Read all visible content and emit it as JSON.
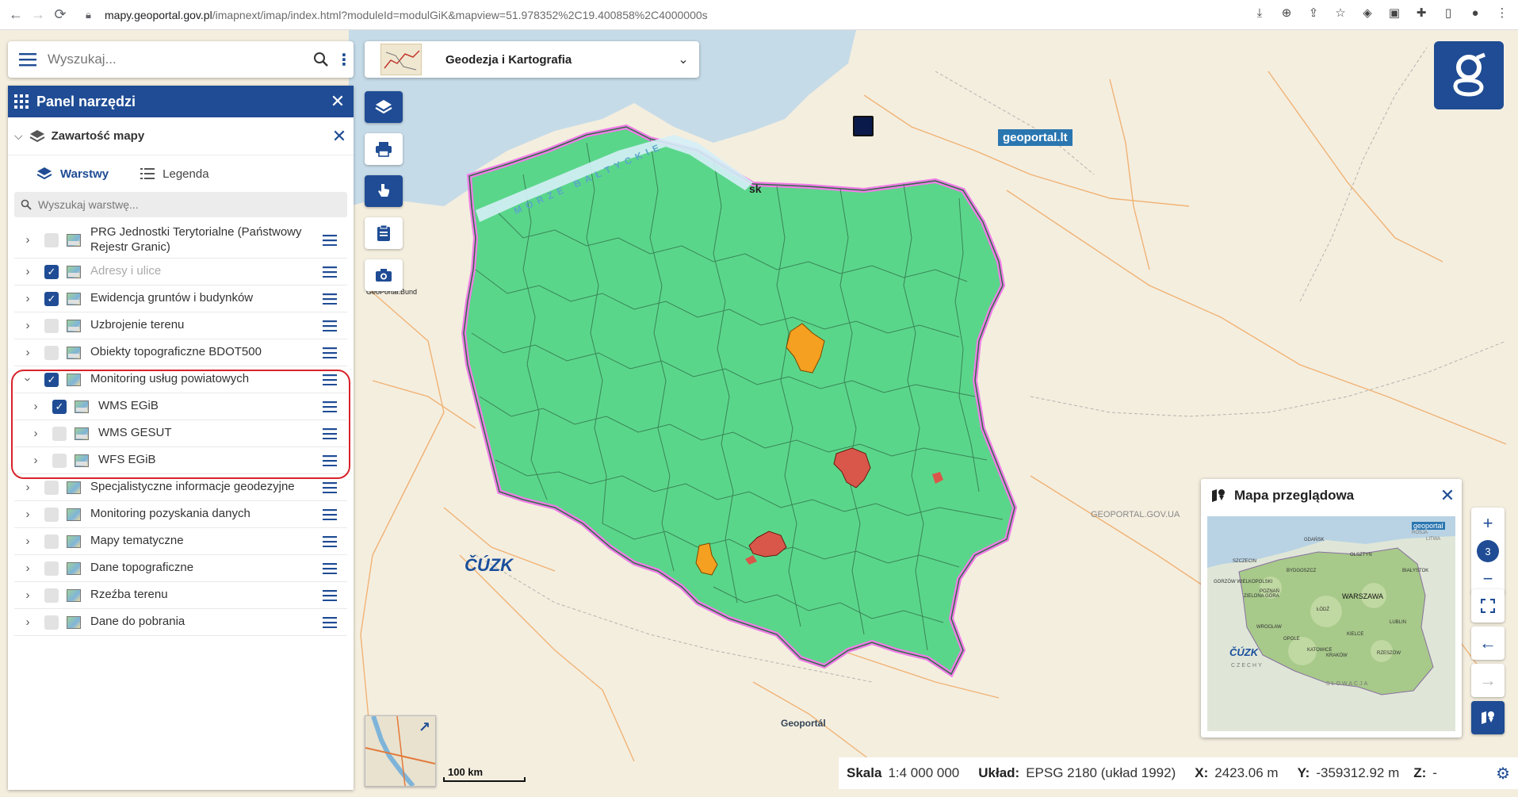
{
  "browser": {
    "url_host": "mapy.geoportal.gov.pl",
    "url_path": "/imapnext/imap/index.html?moduleId=modulGiK&mapview=51.978352%2C19.400858%2C4000000s"
  },
  "search": {
    "placeholder": "Wyszukaj..."
  },
  "panel": {
    "title": "Panel narzędzi",
    "section_title": "Zawartość mapy",
    "tabs": [
      {
        "label": "Warstwy"
      },
      {
        "label": "Legenda"
      }
    ],
    "layer_search_placeholder": "Wyszukaj warstwę...",
    "layers": [
      {
        "label": "PRG Jednostki Terytorialne (Państwowy Rejestr Granic)",
        "checked": false,
        "icon": "wms"
      },
      {
        "label": "Adresy i ulice",
        "checked": true,
        "icon": "wms",
        "dim": true
      },
      {
        "label": "Ewidencja gruntów i budynków",
        "checked": true,
        "icon": "wms"
      },
      {
        "label": "Uzbrojenie terenu",
        "checked": false,
        "icon": "wms"
      },
      {
        "label": "Obiekty topograficzne BDOT500",
        "checked": false,
        "icon": "wms"
      },
      {
        "label": "Monitoring usług powiatowych",
        "checked": true,
        "icon": "group",
        "expanded": true
      },
      {
        "label": "WMS EGiB",
        "checked": true,
        "icon": "wms",
        "sub": true
      },
      {
        "label": "WMS GESUT",
        "checked": false,
        "icon": "wms",
        "sub": true
      },
      {
        "label": "WFS EGiB",
        "checked": false,
        "icon": "wms",
        "sub": true
      },
      {
        "label": "Specjalistyczne informacje geodezyjne",
        "checked": false,
        "icon": "group"
      },
      {
        "label": "Monitoring pozyskania danych",
        "checked": false,
        "icon": "group"
      },
      {
        "label": "Mapy tematyczne",
        "checked": false,
        "icon": "group"
      },
      {
        "label": "Dane topograficzne",
        "checked": false,
        "icon": "group"
      },
      {
        "label": "Rzeźba terenu",
        "checked": false,
        "icon": "group"
      },
      {
        "label": "Dane do pobrania",
        "checked": false,
        "icon": "group"
      }
    ]
  },
  "combo": {
    "label": "Geodezja i Kartografia"
  },
  "map_labels": {
    "sea": "MORZE BAŁTYCKIE",
    "cuzk": "ČÚZK",
    "geoportal_lt": "geoportal.lt",
    "geoportal_ua": "GEOPORTAL.GOV.UA",
    "geoportal_sk": "Geoportál",
    "geoportal_bund": "GeoPortal.Bund",
    "ostsee_fragment": "sk"
  },
  "overview": {
    "title": "Mapa przeglądowa",
    "labels": [
      "GDAŃSK",
      "OLSZTYN",
      "SZCZECIN",
      "BYDGOSZCZ",
      "BIAŁYSTOK",
      "GORZÓW WIELKOPOLSKI",
      "POZNAŃ",
      "WARSZAWA",
      "ZIELONA GÓRA",
      "ŁÓDŹ",
      "LUBLIN",
      "WROCŁAW",
      "KIELCE",
      "OPOLE",
      "KATOWICE",
      "KRAKÓW",
      "RZESZÓW",
      "CZECHY",
      "SŁOWACJA",
      "ROSJA",
      "LITWA",
      "ČÚZK",
      "geoportal"
    ]
  },
  "zoom": {
    "level": "3"
  },
  "scalebar": {
    "label": "100 km"
  },
  "status": {
    "scale_label": "Skala",
    "scale_value": "1:4 000 000",
    "crs_label": "Układ:",
    "crs_value": "EPSG 2180 (układ 1992)",
    "x_label": "X:",
    "x_value": "2423.06 m",
    "y_label": "Y:",
    "y_value": "-359312.92 m",
    "z_label": "Z:",
    "z_value": "-"
  },
  "colors": {
    "brand": "#1f4c94",
    "county_ok": "#5ad68a",
    "county_warn": "#f5a020",
    "county_err": "#d9574a",
    "highlight": "#d8232a"
  }
}
